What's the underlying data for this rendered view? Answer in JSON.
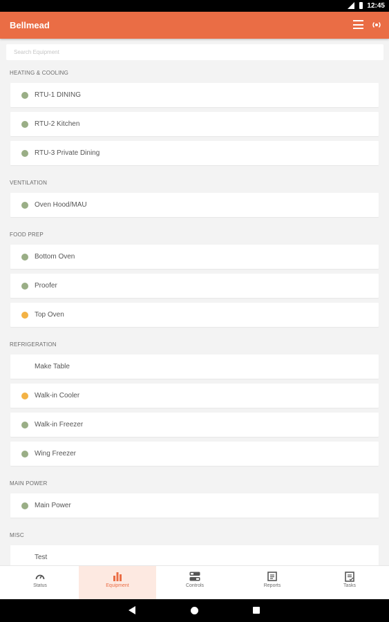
{
  "status_bar": {
    "time": "12:45"
  },
  "app": {
    "title": "Bellmead"
  },
  "search": {
    "placeholder": "Search Equipment"
  },
  "colors": {
    "accent": "#ea6d45",
    "ok": "#9aae86",
    "warning": "#f3b245"
  },
  "sections": [
    {
      "title": "HEATING & COOLING",
      "items": [
        {
          "name": "RTU-1 DINING",
          "status": "ok"
        },
        {
          "name": "RTU-2 Kitchen",
          "status": "ok"
        },
        {
          "name": "RTU-3 Private Dining",
          "status": "ok"
        }
      ]
    },
    {
      "title": "VENTILATION",
      "items": [
        {
          "name": "Oven Hood/MAU",
          "status": "ok"
        }
      ]
    },
    {
      "title": "FOOD PREP",
      "items": [
        {
          "name": "Bottom Oven",
          "status": "ok"
        },
        {
          "name": "Proofer",
          "status": "ok"
        },
        {
          "name": "Top Oven",
          "status": "warning"
        }
      ]
    },
    {
      "title": "REFRIGERATION",
      "items": [
        {
          "name": "Make Table",
          "status": "none"
        },
        {
          "name": "Walk-in Cooler",
          "status": "warning"
        },
        {
          "name": "Walk-in Freezer",
          "status": "ok"
        },
        {
          "name": "Wing Freezer",
          "status": "ok"
        }
      ]
    },
    {
      "title": "MAIN POWER",
      "items": [
        {
          "name": "Main Power",
          "status": "ok"
        }
      ]
    },
    {
      "title": "MISC",
      "items": [
        {
          "name": "Test",
          "status": "none"
        }
      ]
    }
  ],
  "bottom_nav": [
    {
      "label": "Status",
      "icon": "gauge-icon",
      "active": false
    },
    {
      "label": "Equipment",
      "icon": "bar-chart-icon",
      "active": true
    },
    {
      "label": "Controls",
      "icon": "toggles-icon",
      "active": false
    },
    {
      "label": "Reports",
      "icon": "report-icon",
      "active": false
    },
    {
      "label": "Tasks",
      "icon": "checklist-icon",
      "active": false
    }
  ]
}
